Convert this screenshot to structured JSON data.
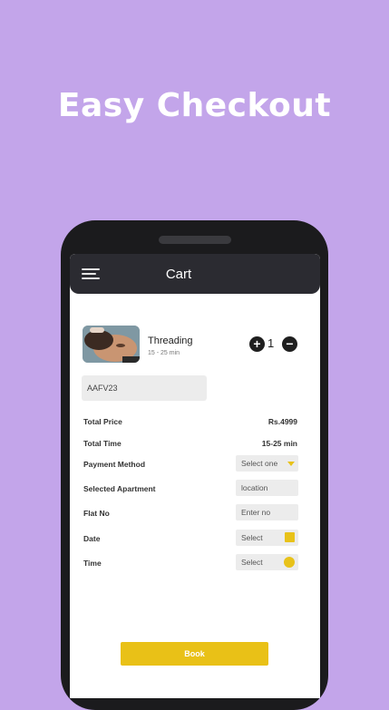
{
  "headline": "Easy Checkout",
  "appbar": {
    "title": "Cart",
    "menu_icon": "hamburger-menu-icon"
  },
  "cart_item": {
    "name": "Threading",
    "duration": "15 - 25 min",
    "quantity": "1",
    "increment_label": "+",
    "decrement_label": "−"
  },
  "coupon": {
    "value": "AAFV23"
  },
  "summary": {
    "total_price_label": "Total Price",
    "total_price_value": "Rs.4999",
    "total_time_label": "Total Time",
    "total_time_value": "15-25 min"
  },
  "form": {
    "payment_method_label": "Payment Method",
    "payment_method_value": "Select one",
    "apartment_label": "Selected Apartment",
    "apartment_value": "location",
    "flat_label": "Flat No",
    "flat_placeholder": "Enter no",
    "date_label": "Date",
    "date_value": "Select",
    "time_label": "Time",
    "time_value": "Select"
  },
  "book_button": "Book",
  "colors": {
    "background": "#c3a5ea",
    "appbar": "#2b2b31",
    "accent": "#e9c117"
  }
}
